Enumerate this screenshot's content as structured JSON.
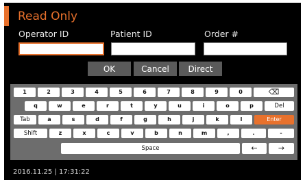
{
  "title": "Read Only",
  "fields": {
    "operator_label": "Operator ID",
    "patient_label": "Patient ID",
    "order_label": "Order #",
    "operator_value": "",
    "patient_value": "",
    "order_value": ""
  },
  "actions": {
    "ok": "OK",
    "cancel": "Cancel",
    "direct": "Direct"
  },
  "keyboard": {
    "row1": [
      "1",
      "2",
      "3",
      "4",
      "5",
      "6",
      "7",
      "8",
      "9",
      "0",
      "⌫"
    ],
    "row2": [
      "q",
      "w",
      "e",
      "r",
      "t",
      "y",
      "u",
      "i",
      "o",
      "p",
      "Del"
    ],
    "row3": [
      "Tab",
      "a",
      "s",
      "d",
      "f",
      "g",
      "h",
      "j",
      "k",
      "l",
      "Enter"
    ],
    "row4": [
      "Shift",
      "z",
      "x",
      "c",
      "v",
      "b",
      "n",
      "m",
      ",",
      ".",
      "-"
    ],
    "space": "Space",
    "left_arrow": "←",
    "right_arrow": "→"
  },
  "status": {
    "datetime": "2016.11.25 | 17:31:22"
  },
  "colors": {
    "accent": "#e8712c",
    "background": "#000000",
    "keyboard_bg": "#6d6d6d",
    "action_button": "#5a5a5a"
  }
}
